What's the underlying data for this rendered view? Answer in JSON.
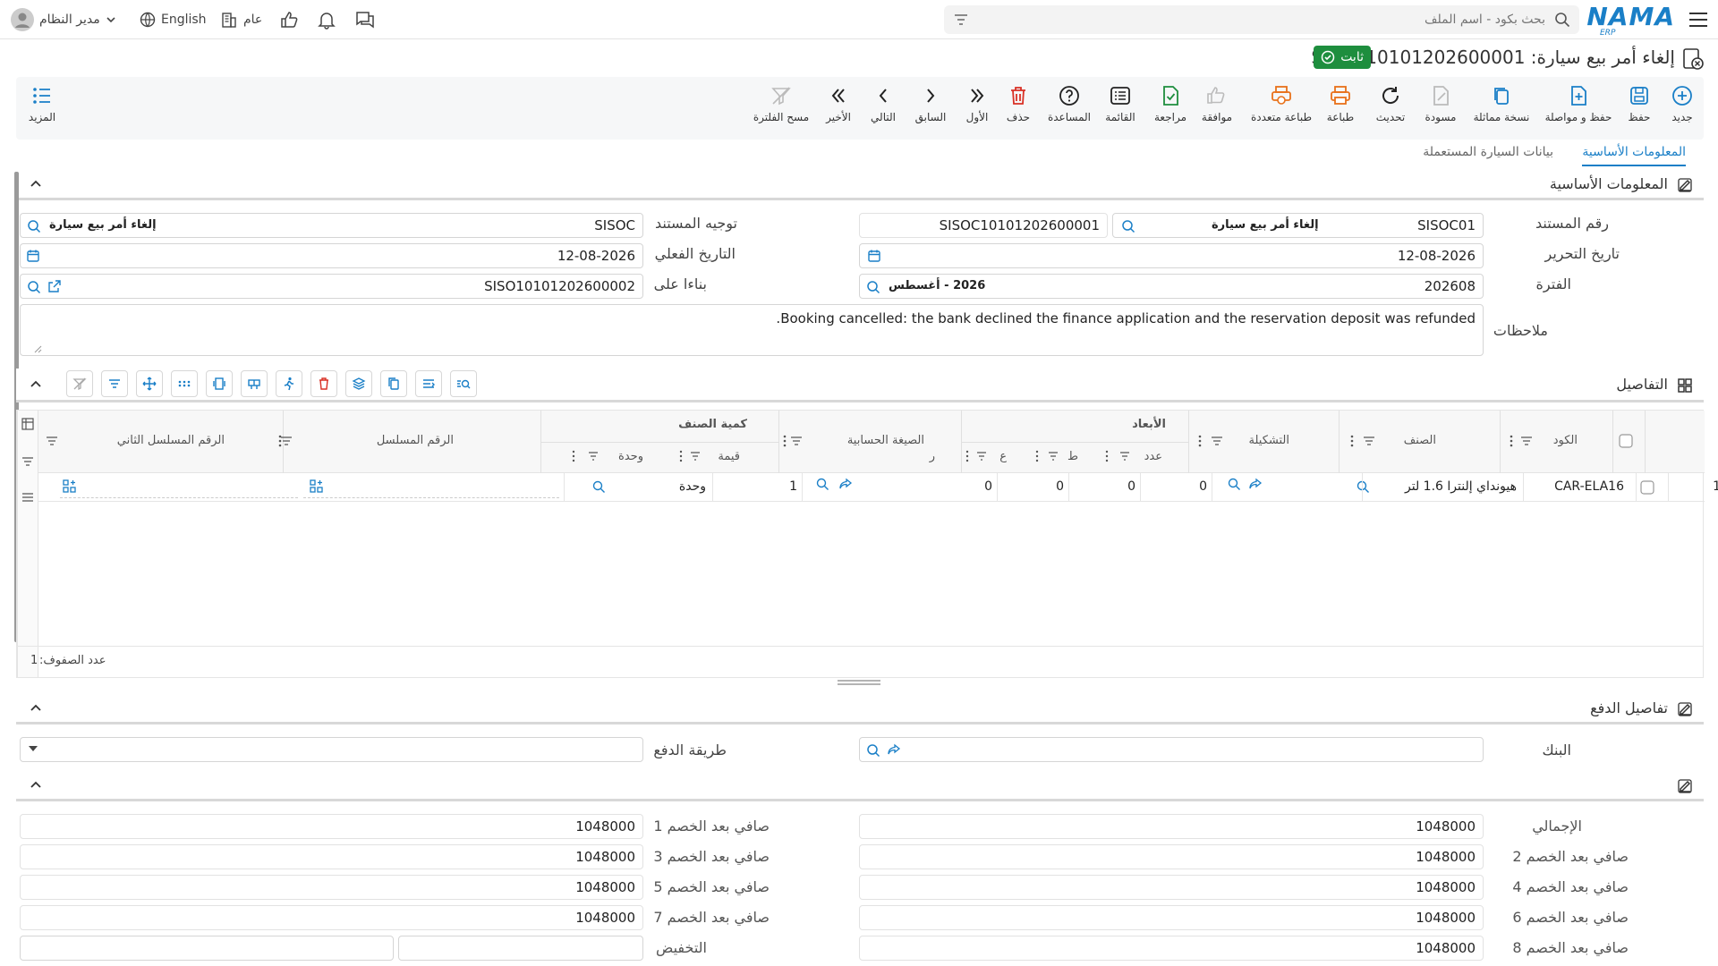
{
  "header": {
    "logo_text": "NAMA",
    "logo_sub": "ERP",
    "search_placeholder": "بحث بكود - اسم الملف",
    "user_name": "مدير النظام",
    "language": "English",
    "scope": "عام"
  },
  "title": {
    "text": "إلغاء أمر بيع سيارة: SISOC10101202600001",
    "status": "ثابت"
  },
  "toolbar": {
    "new": "جديد",
    "save": "حفظ",
    "save_continue": "حفظ و مواصلة",
    "copy_similar": "نسخة مماثلة",
    "draft": "مسودة",
    "refresh": "تحديث",
    "print": "طباعة",
    "multi_print": "طباعة متعددة",
    "approve": "موافقة",
    "review": "مراجعة",
    "list": "القائمة",
    "help": "المساعدة",
    "delete": "حذف",
    "first": "الأول",
    "previous": "السابق",
    "next": "التالي",
    "last": "الأخير",
    "clear_filter": "مسح الفلترة",
    "more": "المزيد"
  },
  "tabs": {
    "basic": "المعلومات الأساسية",
    "used_car": "بيانات السيارة المستعملة"
  },
  "basic": {
    "section_title": "المعلومات الأساسية",
    "doc_no_label": "رقم المستند",
    "doc_no_prefix": "SISOC01",
    "doc_type": "إلغاء أمر بيع سيارة",
    "doc_no": "SISOC10101202600001",
    "direction_label": "توجيه المستند",
    "direction_code": "SISOC",
    "direction_name": "إلغاء أمر بيع سيارة",
    "edit_date_label": "تاريخ التحرير",
    "edit_date": "12-08-2026",
    "actual_date_label": "التاريخ الفعلي",
    "actual_date": "12-08-2026",
    "period_label": "الفترة",
    "period_code": "202608",
    "period_name": "2026 - أغسطس",
    "based_on_label": "بناءا على",
    "based_on": "SISO10101202600002",
    "notes_label": "ملاحظات",
    "notes": "Booking cancelled: the bank declined the finance application and the reservation deposit was refunded."
  },
  "details": {
    "section_title": "التفاصيل",
    "headers": {
      "code": "الكود",
      "item": "الصنف",
      "config": "التشكيلة",
      "dimensions": "الأبعاد",
      "count": "عدد",
      "t": "ط",
      "a": "ع",
      "r": "ر",
      "formula": "الصيغة الحسابية",
      "qty": "كمية الصنف",
      "value": "قيمة",
      "unit": "وحدة",
      "serial": "الرقم المسلسل",
      "serial2": "الرقم المسلسل الثاني"
    },
    "rows": [
      {
        "no": "1",
        "code": "CAR-ELA16",
        "item": "هيونداي إلنترا 1.6 لتر",
        "count": "0",
        "t": "0",
        "a": "0",
        "r": "0",
        "value": "1",
        "unit": "وحدة"
      }
    ],
    "row_count_label": "عدد الصفوف:",
    "row_count": "1"
  },
  "payment": {
    "section_title": "تفاصيل الدفع",
    "bank_label": "البنك",
    "method_label": "طريقة الدفع"
  },
  "totals": {
    "total_label": "الإجمالي",
    "total": "1048000",
    "n1_label": "صافي بعد الخصم 1",
    "n1": "1048000",
    "n2_label": "صافي بعد الخصم 2",
    "n2": "1048000",
    "n3_label": "صافي بعد الخصم 3",
    "n3": "1048000",
    "n4_label": "صافي بعد الخصم 4",
    "n4": "1048000",
    "n5_label": "صافي بعد الخصم 5",
    "n5": "1048000",
    "n6_label": "صافي بعد الخصم 6",
    "n6": "1048000",
    "n7_label": "صافي بعد الخصم 7",
    "n7": "1048000",
    "n8_label": "صافي بعد الخصم 8",
    "n8": "1048000",
    "discount_label": "التخفيض"
  },
  "colors": {
    "accent": "#1a7fc7",
    "status_green": "#1e8e3e",
    "print_orange": "#e8711a",
    "delete_red": "#d93025"
  }
}
